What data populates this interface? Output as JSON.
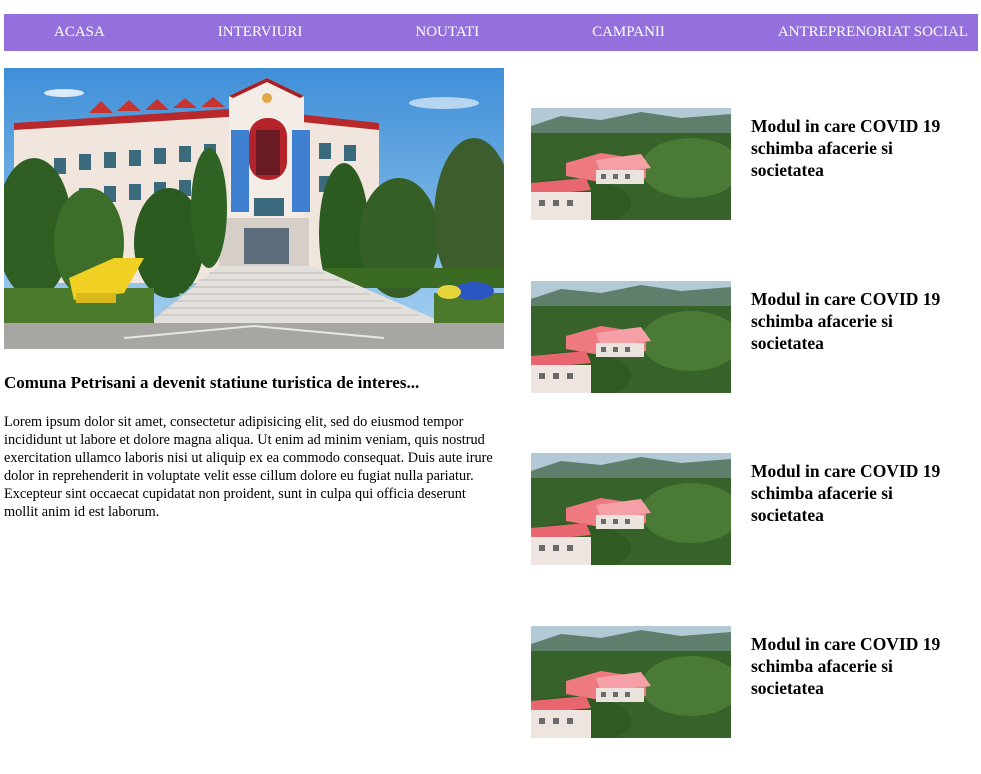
{
  "nav": {
    "items": [
      {
        "label": "ACASA"
      },
      {
        "label": "INTERVIURI"
      },
      {
        "label": "NOUTATI"
      },
      {
        "label": "CAMPANII"
      },
      {
        "label": "ANTREPRENORIAT SOCIAL"
      }
    ],
    "background_color": "#9370db"
  },
  "main_article": {
    "title": "Comuna Petrisani a devenit statiune turistica de interes...",
    "body": "Lorem ipsum dolor sit amet, consectetur adipisicing elit, sed do eiusmod tempor incididunt ut labore et dolore magna aliqua. Ut enim ad minim veniam, quis nostrud exercitation ullamco laboris nisi ut aliquip ex ea commodo consequat. Duis aute irure dolor in reprehenderit in voluptate velit esse cillum dolore eu fugiat nulla pariatur. Excepteur sint occaecat cupidatat non proident, sunt in culpa qui officia deserunt mollit anim id est laborum."
  },
  "side_articles": [
    {
      "title": "Modul in care COVID 19 schimba afacerie si societatea"
    },
    {
      "title": "Modul in care COVID 19 schimba afacerie si societatea"
    },
    {
      "title": "Modul in care COVID 19 schimba afacerie si societatea"
    },
    {
      "title": "Modul in care COVID 19 schimba afacerie si societatea"
    }
  ]
}
